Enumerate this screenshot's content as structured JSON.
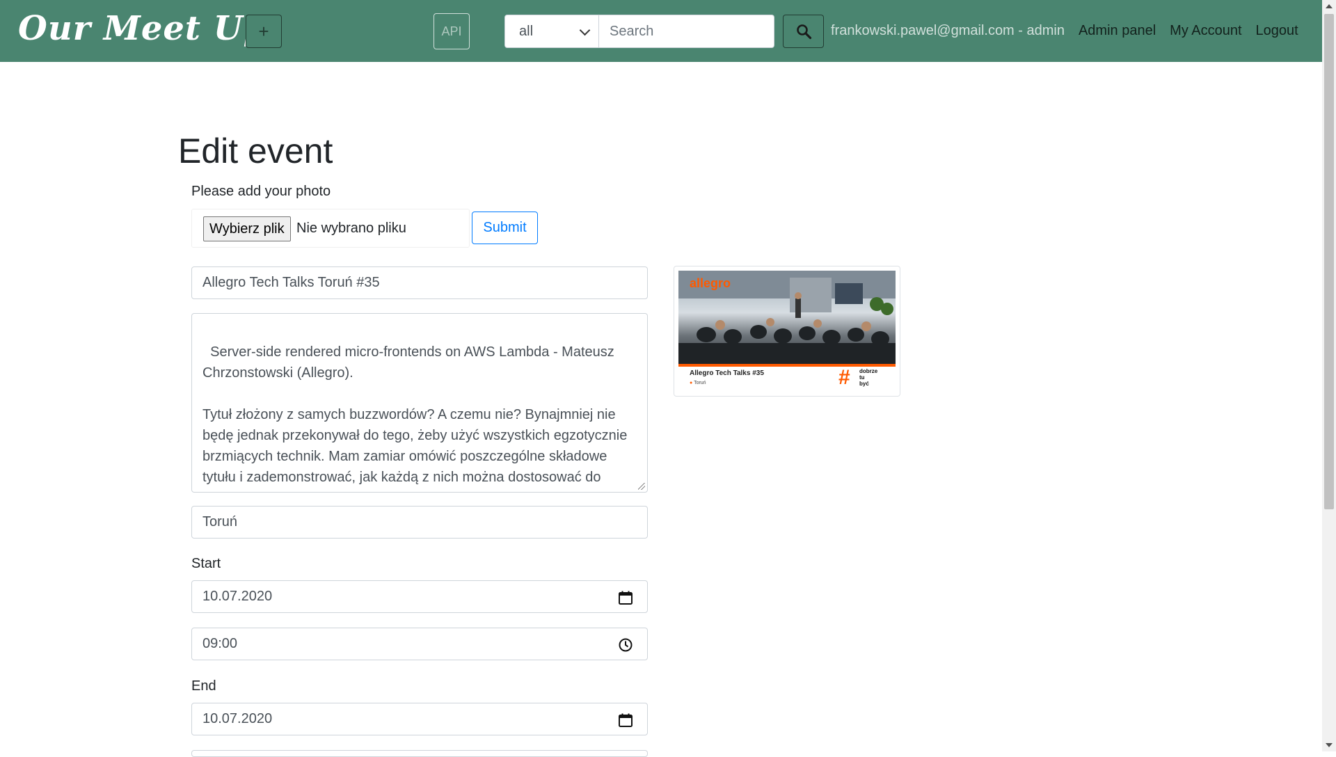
{
  "navbar": {
    "brand": "Our Meet Up",
    "add_icon_glyph": "+",
    "api_label": "API",
    "search": {
      "scope_value": "all",
      "placeholder": "Search",
      "value": ""
    },
    "user_label": "frankowski.pawel@gmail.com - admin",
    "admin_panel": "Admin panel",
    "my_account": "My Account",
    "logout": "Logout"
  },
  "page": {
    "title": "Edit event",
    "photo_prompt": "Please add your photo",
    "file_button": "Wybierz plik",
    "file_status": "Nie wybrano pliku",
    "submit": "Submit"
  },
  "form": {
    "name": "Allegro Tech Talks Toruń #35",
    "description": "Server-side rendered micro-frontends on AWS Lambda - Mateusz Chrzonstowski (Allegro).\n\nTytuł złożony z samych buzzwordów? A czemu nie? Bynajmniej nie będę jednak przekonywał do tego, żeby użyć wszystkich egzotycznie brzmiących technik. Mam zamiar omówić poszczególne składowe tytułu i zademonstrować, jak każdą z nich można dostosować do swoich potrzeb.",
    "location": "Toruń",
    "start_label": "Start",
    "start_date": "10.07.2020",
    "start_time": "09:00",
    "end_label": "End",
    "end_date": "10.07.2020"
  },
  "thumbnail": {
    "logo_text": "allegro",
    "caption": "Allegro Tech Talks #35",
    "location": "Toruń",
    "hash": "#",
    "slogan": "dobrze\ntu\nbyć"
  },
  "icons": {
    "search": "search-icon",
    "calendar": "calendar-icon",
    "clock": "clock-icon"
  },
  "colors": {
    "navbar": "#4a8570",
    "primary": "#007bff",
    "brand_accent": "#ff5a00"
  }
}
